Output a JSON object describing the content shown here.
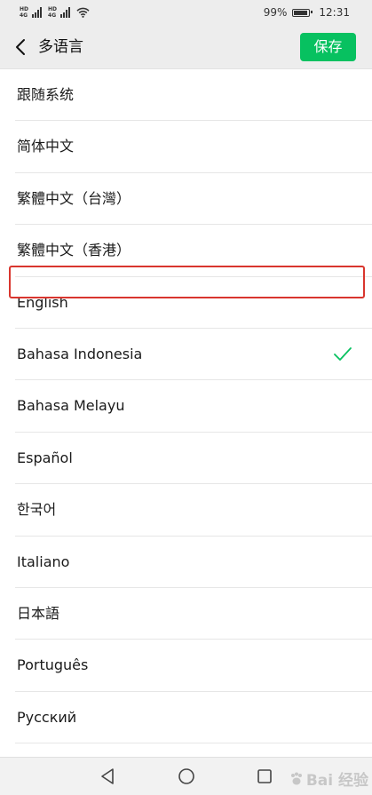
{
  "status_bar": {
    "network_type_1": "HD",
    "network_tag_1": "4G",
    "network_type_2": "HD",
    "network_tag_2": "4G",
    "battery_percent": "99%",
    "battery_level": 0.99,
    "time": "12:31"
  },
  "header": {
    "title": "多语言",
    "save_label": "保存",
    "accent_color": "#07c160"
  },
  "languages": [
    {
      "label": "跟随系统",
      "selected": false
    },
    {
      "label": "简体中文",
      "selected": false
    },
    {
      "label": "繁體中文（台灣）",
      "selected": false
    },
    {
      "label": "繁體中文（香港）",
      "selected": false
    },
    {
      "label": "English",
      "selected": false
    },
    {
      "label": "Bahasa Indonesia",
      "selected": true
    },
    {
      "label": "Bahasa Melayu",
      "selected": false
    },
    {
      "label": "Español",
      "selected": false
    },
    {
      "label": "한국어",
      "selected": false
    },
    {
      "label": "Italiano",
      "selected": false
    },
    {
      "label": "日本語",
      "selected": false
    },
    {
      "label": "Português",
      "selected": false
    },
    {
      "label": "Русский",
      "selected": false
    }
  ],
  "highlight_color": "#d9362e",
  "icons": {
    "back": "chevron-left-icon",
    "check": "checkmark-icon",
    "nav_back": "triangle-back-icon",
    "nav_home": "circle-home-icon",
    "nav_recent": "square-recent-icon"
  },
  "watermark": {
    "text": "Bai 经验"
  }
}
